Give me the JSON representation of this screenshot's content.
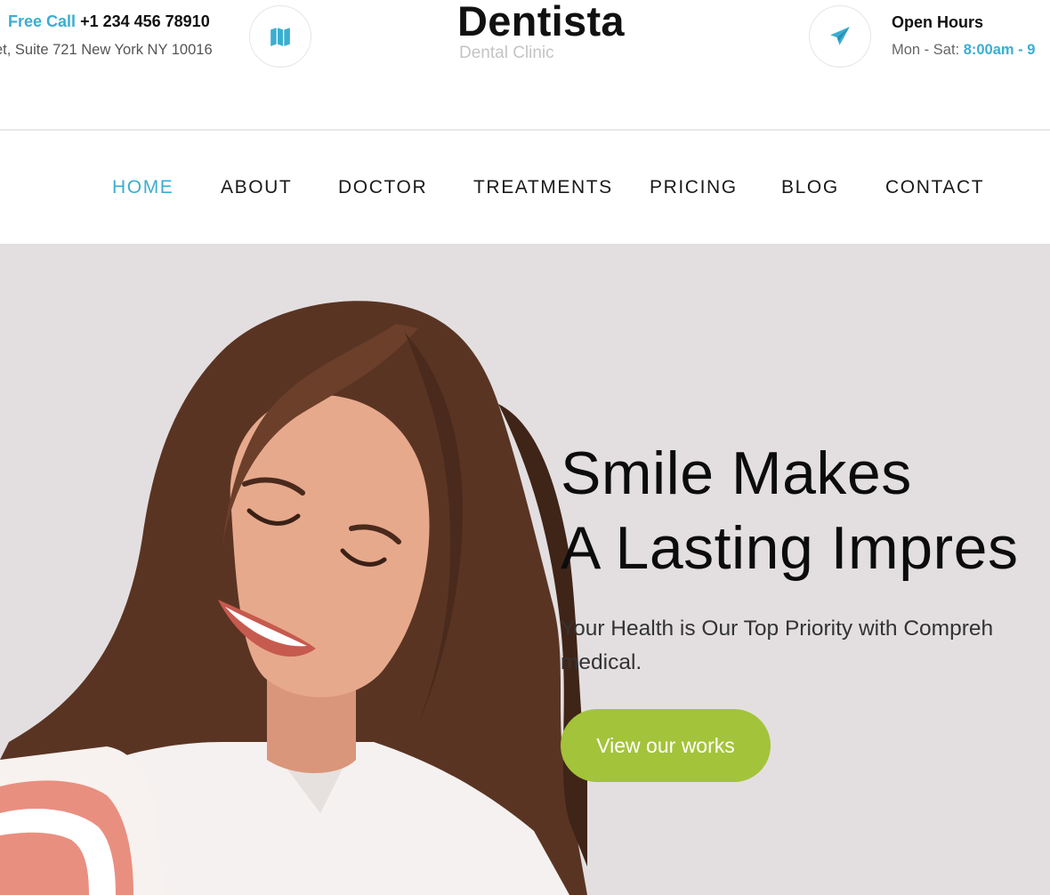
{
  "header": {
    "call_label": "Free Call",
    "call_number": "+1 234 456 78910",
    "address": "et, Suite 721 New York NY 10016",
    "logo_title": "Dentista",
    "logo_subtitle": "Dental Clinic",
    "hours_title": "Open Hours",
    "hours_days": "Mon - Sat: ",
    "hours_time": "8:00am - 9",
    "icons": [
      "map-icon",
      "paper-plane-icon"
    ]
  },
  "nav": {
    "items": [
      {
        "label": "HOME",
        "active": true
      },
      {
        "label": "ABOUT",
        "active": false
      },
      {
        "label": "DOCTOR",
        "active": false
      },
      {
        "label": "TREATMENTS",
        "active": false
      },
      {
        "label": "PRICING",
        "active": false
      },
      {
        "label": "BLOG",
        "active": false
      },
      {
        "label": "CONTACT",
        "active": false
      }
    ]
  },
  "hero": {
    "title_line1": "Smile Makes",
    "title_line2": "A Lasting Impres",
    "text_line1": "Your Health is Our Top Priority with Compreh",
    "text_line2": "medical.",
    "cta_label": "View our works"
  },
  "colors": {
    "accent": "#3aaed1",
    "cta": "#a3c33a",
    "hero_background": "#e3dfe0"
  }
}
